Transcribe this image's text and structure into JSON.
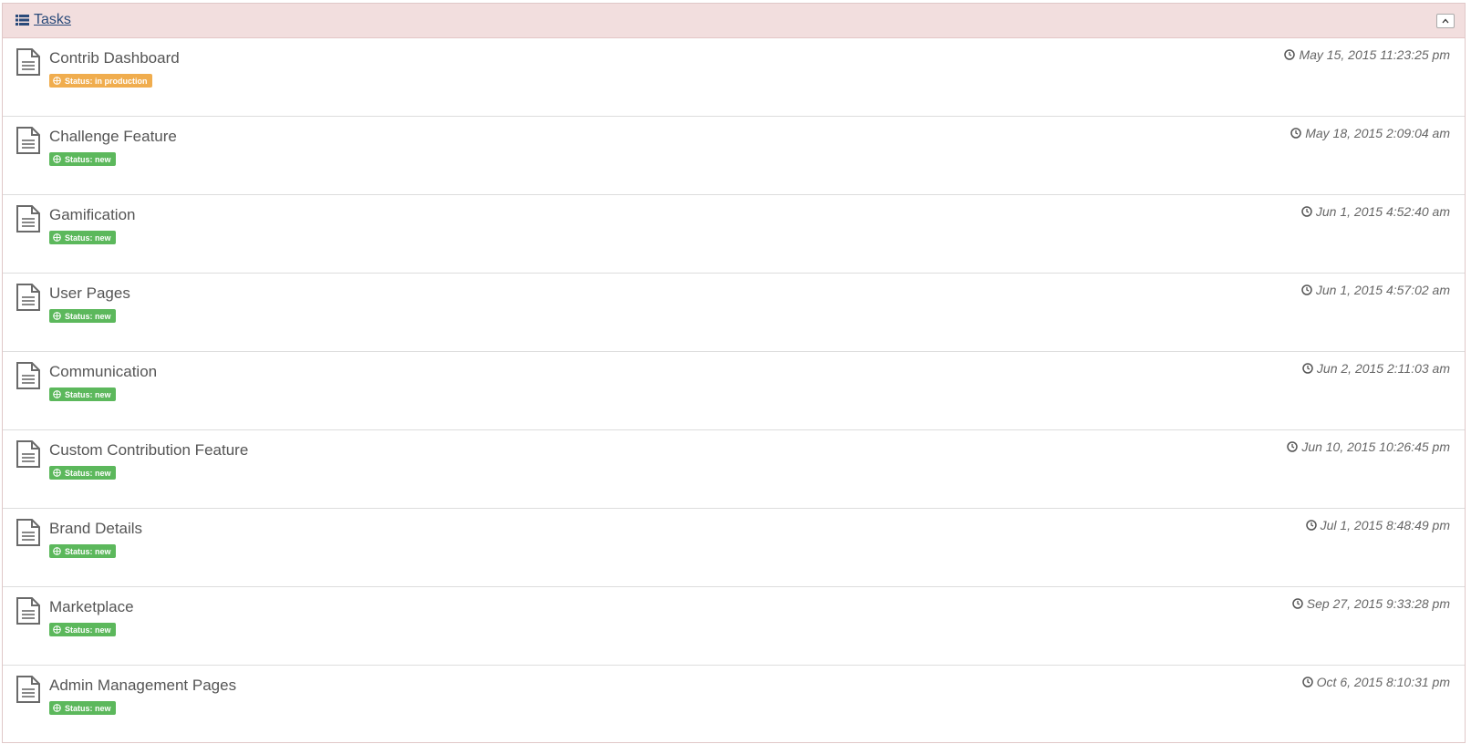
{
  "panel": {
    "title": "Tasks",
    "title_icon": "list-icon",
    "collapse_icon": "chevron-up-icon",
    "header_color": "#f2dede"
  },
  "colors": {
    "status_in_production": "#f0ad4e",
    "status_new": "#5cb85c",
    "title_link": "#2a4a7a"
  },
  "tasks": [
    {
      "title": "Contrib Dashboard",
      "status": "Status: in production",
      "status_type": "in_production",
      "date": "May 15, 2015 11:23:25 pm"
    },
    {
      "title": "Challenge Feature",
      "status": "Status: new",
      "status_type": "new",
      "date": "May 18, 2015 2:09:04 am"
    },
    {
      "title": "Gamification",
      "status": "Status: new",
      "status_type": "new",
      "date": "Jun 1, 2015 4:52:40 am"
    },
    {
      "title": "User Pages",
      "status": "Status: new",
      "status_type": "new",
      "date": "Jun 1, 2015 4:57:02 am"
    },
    {
      "title": "Communication",
      "status": "Status: new",
      "status_type": "new",
      "date": "Jun 2, 2015 2:11:03 am"
    },
    {
      "title": "Custom Contribution Feature",
      "status": "Status: new",
      "status_type": "new",
      "date": "Jun 10, 2015 10:26:45 pm"
    },
    {
      "title": "Brand Details",
      "status": "Status: new",
      "status_type": "new",
      "date": "Jul 1, 2015 8:48:49 pm"
    },
    {
      "title": "Marketplace",
      "status": "Status: new",
      "status_type": "new",
      "date": "Sep 27, 2015 9:33:28 pm"
    },
    {
      "title": "Admin Management Pages",
      "status": "Status: new",
      "status_type": "new",
      "date": "Oct 6, 2015 8:10:31 pm"
    }
  ]
}
